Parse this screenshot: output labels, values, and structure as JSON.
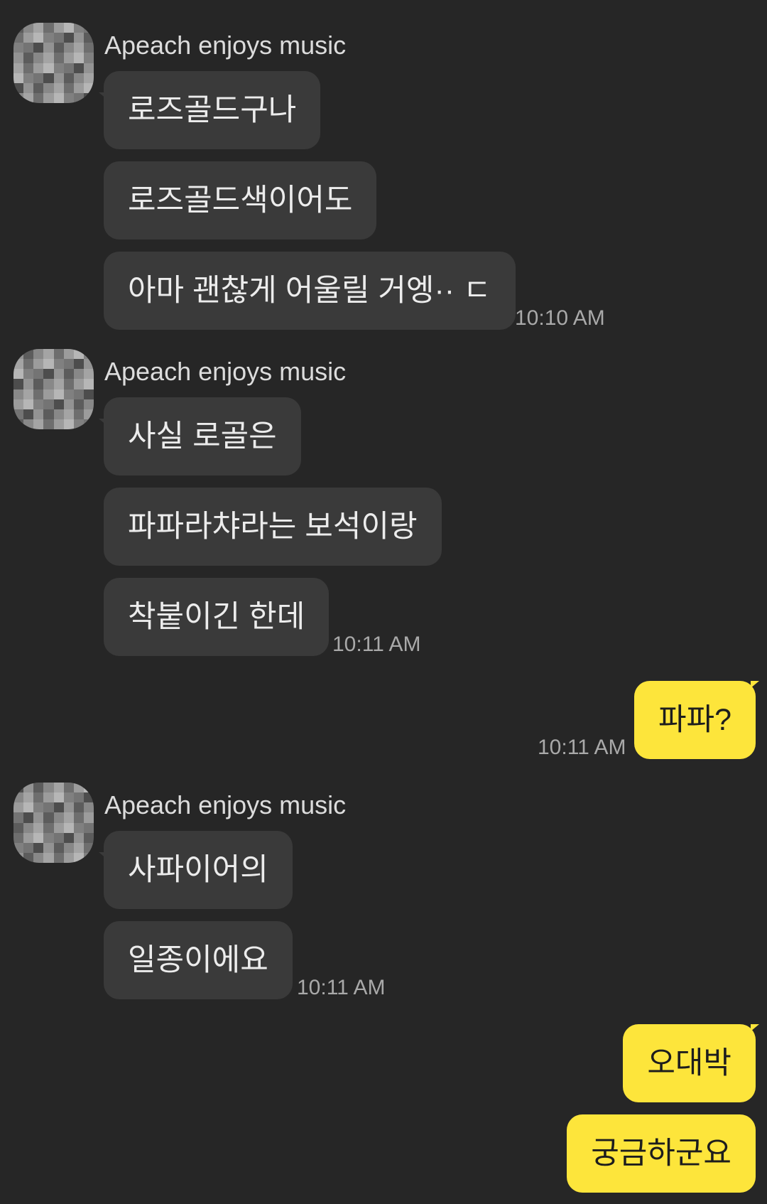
{
  "chat": {
    "groups": [
      {
        "sender": "Apeach enjoys music",
        "messages": [
          "로즈골드구나",
          "로즈골드색이어도",
          "아마 괜찮게 어울릴 거엥·· ㄷ"
        ],
        "time": "10:10 AM"
      },
      {
        "sender": "Apeach enjoys music",
        "messages": [
          "사실 로골은",
          "파파라챠라는 보석이랑",
          "착붙이긴 한데"
        ],
        "time": "10:11 AM"
      },
      {
        "outgoing": true,
        "messages": [
          "파파?"
        ],
        "time": "10:11 AM"
      },
      {
        "sender": "Apeach enjoys music",
        "messages": [
          "사파이어의",
          "일종이에요"
        ],
        "time": "10:11 AM"
      },
      {
        "outgoing": true,
        "messages": [
          "오대박",
          "궁금하군요"
        ]
      }
    ]
  },
  "colors": {
    "background": "#262626",
    "incoming_bubble": "#3a3a3a",
    "outgoing_bubble": "#fde53b",
    "timestamp": "#a9a9a9"
  }
}
